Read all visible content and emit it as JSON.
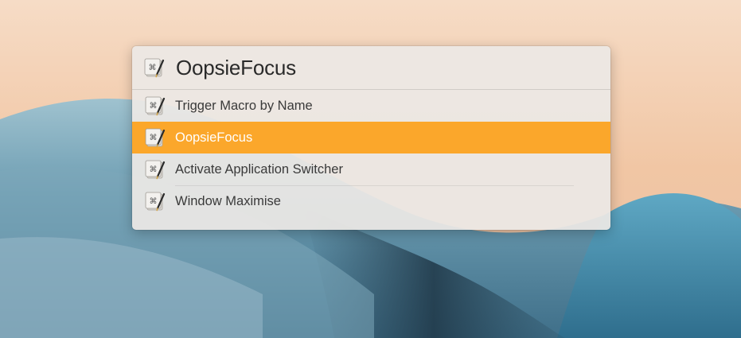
{
  "launcher": {
    "query": "OopsieFocus",
    "results": [
      {
        "label": "Trigger Macro by Name",
        "selected": false
      },
      {
        "label": "OopsieFocus",
        "selected": true
      },
      {
        "label": "Activate Application Switcher",
        "selected": false
      },
      {
        "label": "Window Maximise",
        "selected": false
      }
    ]
  },
  "icons": {
    "app": "keyboard-maestro-icon"
  },
  "colors": {
    "selection": "#fba72b",
    "panel_bg": "#ece8e5"
  }
}
